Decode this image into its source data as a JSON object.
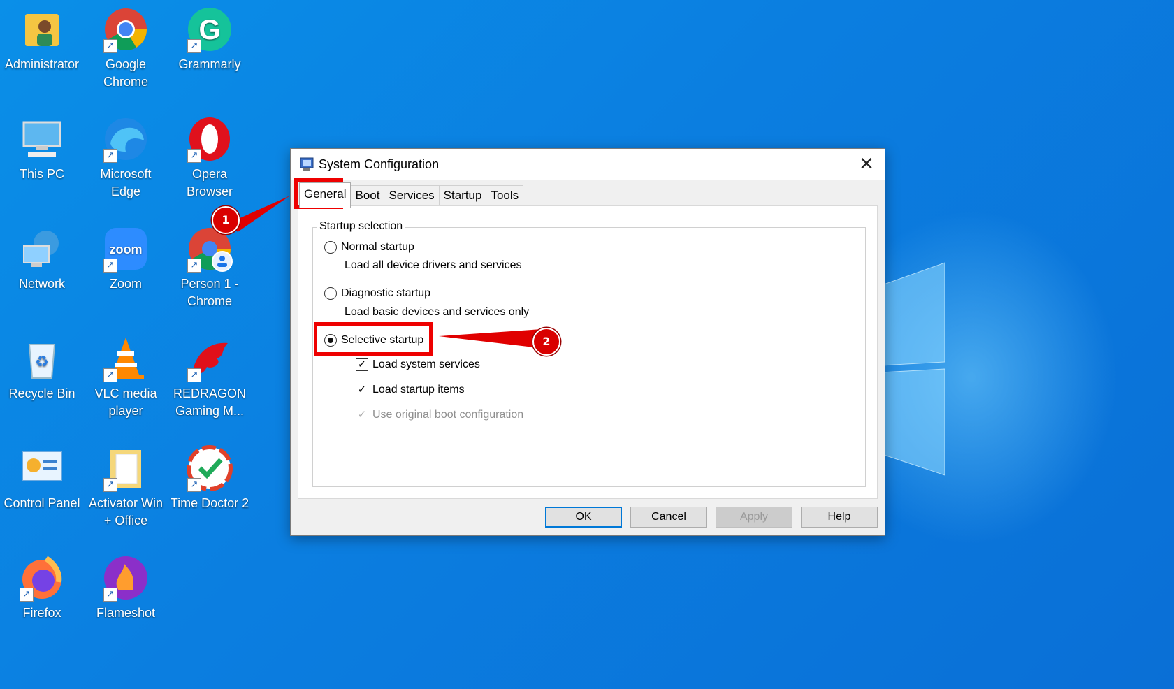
{
  "desktop": {
    "icons": [
      {
        "label": "Administrator",
        "icon": "folder-user-icon"
      },
      {
        "label": "Google Chrome",
        "icon": "chrome-icon"
      },
      {
        "label": "Grammarly",
        "icon": "grammarly-icon"
      },
      {
        "label": "This PC",
        "icon": "computer-icon"
      },
      {
        "label": "Microsoft Edge",
        "icon": "edge-icon"
      },
      {
        "label": "Opera Browser",
        "icon": "opera-icon"
      },
      {
        "label": "Network",
        "icon": "network-icon"
      },
      {
        "label": "Zoom",
        "icon": "zoom-icon"
      },
      {
        "label": "Person 1 - Chrome",
        "icon": "chrome-profile-icon"
      },
      {
        "label": "Recycle Bin",
        "icon": "recycle-bin-icon"
      },
      {
        "label": "VLC media player",
        "icon": "vlc-icon"
      },
      {
        "label": "REDRAGON Gaming M...",
        "icon": "redragon-icon"
      },
      {
        "label": "Control Panel",
        "icon": "control-panel-icon"
      },
      {
        "label": "Activator Win + Office",
        "icon": "folder-icon"
      },
      {
        "label": "Time Doctor 2",
        "icon": "time-doctor-icon"
      },
      {
        "label": "Firefox",
        "icon": "firefox-icon"
      },
      {
        "label": "Flameshot",
        "icon": "flameshot-icon"
      }
    ]
  },
  "dialog": {
    "title": "System Configuration",
    "tabs": [
      "General",
      "Boot",
      "Services",
      "Startup",
      "Tools"
    ],
    "active_tab": "General",
    "group_label": "Startup selection",
    "options": {
      "normal": {
        "label": "Normal startup",
        "desc": "Load all device drivers and services"
      },
      "diagnostic": {
        "label": "Diagnostic startup",
        "desc": "Load basic devices and services only"
      },
      "selective": {
        "label": "Selective startup"
      }
    },
    "checkboxes": {
      "system_services": {
        "label": "Load system services",
        "checked": true
      },
      "startup_items": {
        "label": "Load startup items",
        "checked": true
      },
      "original_boot": {
        "label": "Use original boot configuration",
        "checked": true,
        "disabled": true
      }
    },
    "buttons": {
      "ok": "OK",
      "cancel": "Cancel",
      "apply": "Apply",
      "help": "Help"
    }
  },
  "annotations": {
    "step1": "1",
    "step2": "2",
    "highlight_color": "#e00000"
  }
}
